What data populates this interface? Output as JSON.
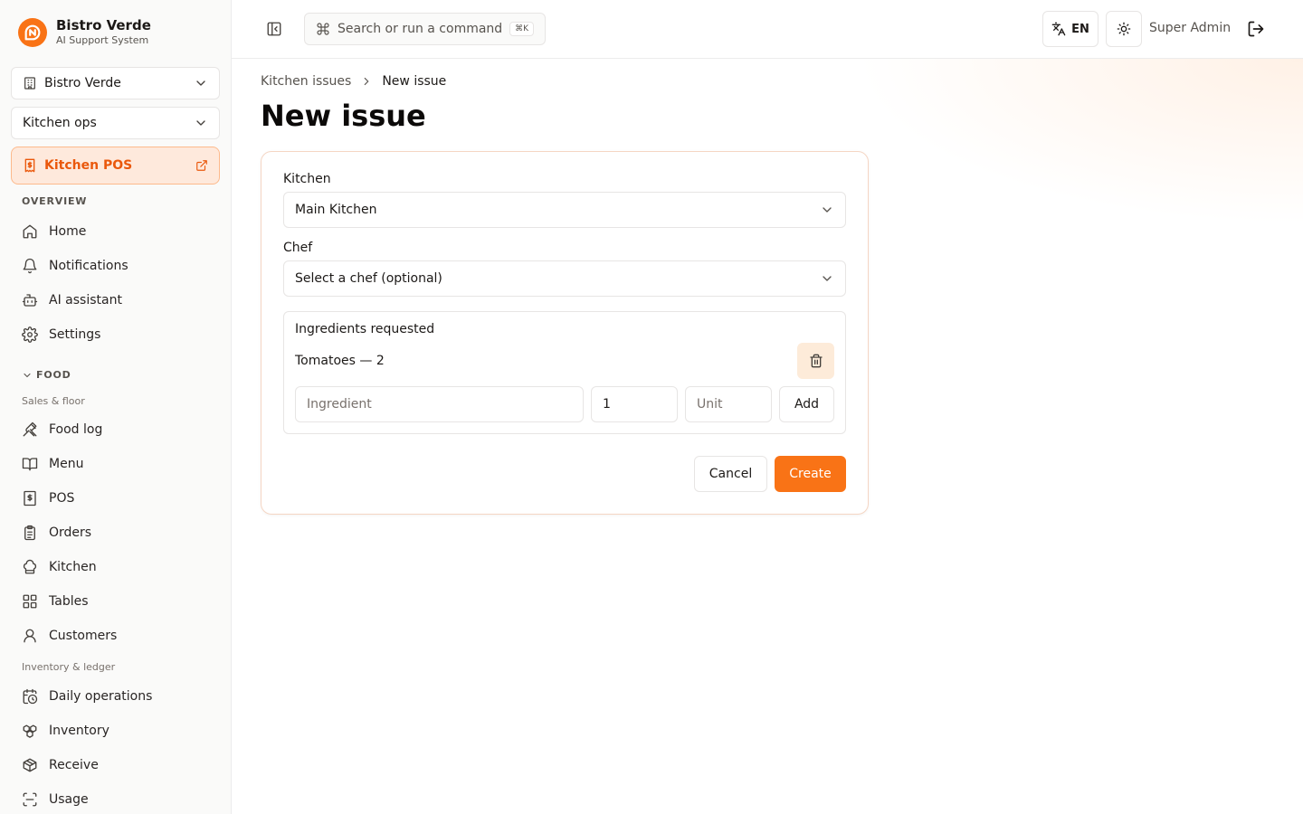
{
  "brand": {
    "name": "Bistro Verde",
    "subtitle": "AI Support System"
  },
  "sidebar": {
    "restaurant_select": "Bistro Verde",
    "workspace_select": "Kitchen ops",
    "pos_button": "Kitchen POS",
    "overview_label": "OVERVIEW",
    "overview_items": [
      {
        "label": "Home",
        "icon": "home-icon"
      },
      {
        "label": "Notifications",
        "icon": "bell-icon"
      },
      {
        "label": "AI assistant",
        "icon": "bot-icon"
      },
      {
        "label": "Settings",
        "icon": "gear-icon"
      }
    ],
    "food_label": "FOOD",
    "sales_label": "Sales & floor",
    "sales_items": [
      {
        "label": "Food log",
        "icon": "utensils-icon"
      },
      {
        "label": "Menu",
        "icon": "book-icon"
      },
      {
        "label": "POS",
        "icon": "receipt-icon"
      },
      {
        "label": "Orders",
        "icon": "clipboard-icon"
      },
      {
        "label": "Kitchen",
        "icon": "chef-hat-icon"
      },
      {
        "label": "Tables",
        "icon": "grid-icon"
      },
      {
        "label": "Customers",
        "icon": "user-icon"
      }
    ],
    "inventory_label": "Inventory & ledger",
    "inventory_items": [
      {
        "label": "Daily operations",
        "icon": "calendar-clock-icon"
      },
      {
        "label": "Inventory",
        "icon": "boxes-icon"
      },
      {
        "label": "Receive",
        "icon": "package-icon"
      },
      {
        "label": "Usage",
        "icon": "scan-icon"
      }
    ]
  },
  "topbar": {
    "search_placeholder": "Search or run a command",
    "search_shortcut": "⌘K",
    "language": "EN",
    "user": "Super Admin"
  },
  "main": {
    "breadcrumb": {
      "parent": "Kitchen issues",
      "current": "New issue"
    },
    "title": "New issue",
    "form": {
      "kitchen_label": "Kitchen",
      "kitchen_value": "Main Kitchen",
      "chef_label": "Chef",
      "chef_value": "Select a chef (optional)",
      "ingredients_title": "Ingredients requested",
      "ingredients": [
        "Tomatoes — 2"
      ],
      "ingredient_placeholder": "Ingredient",
      "quantity_value": "1",
      "unit_placeholder": "Unit",
      "add_label": "Add",
      "cancel_label": "Cancel",
      "create_label": "Create"
    }
  },
  "colors": {
    "accent": "#f97316",
    "accent_soft": "#fee9dc"
  }
}
